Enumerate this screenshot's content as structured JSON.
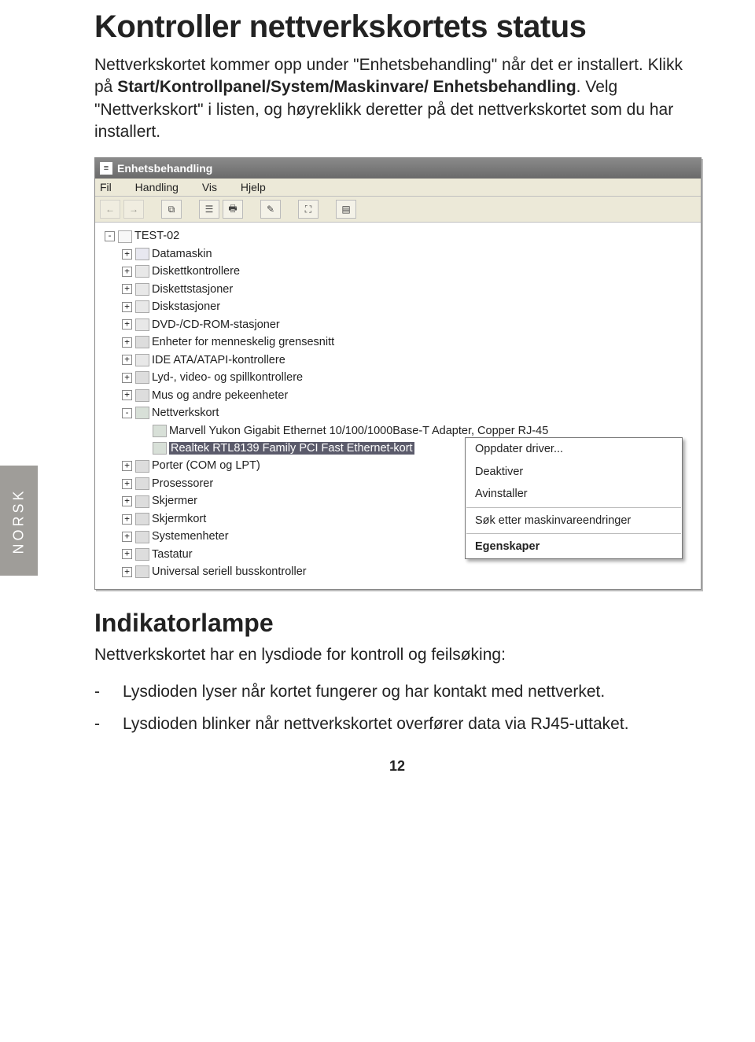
{
  "sidebar_tab": "NORSK",
  "title": "Kontroller nettverkskortets status",
  "intro_1": "Nettverkskortet kommer opp under \"Enhetsbehandling\" når det er installert. Klikk på ",
  "intro_bold": "Start/Kontrollpanel/System/Maskinvare/ Enhetsbehandling",
  "intro_2": ". Velg \"Nettverkskort\" i listen, og høyreklikk deretter på det nettverkskortet som du har installert.",
  "window": {
    "title": "Enhetsbehandling",
    "menu": [
      "Fil",
      "Handling",
      "Vis",
      "Hjelp"
    ],
    "root": "TEST-02",
    "nodes": [
      "Datamaskin",
      "Diskettkontrollere",
      "Diskettstasjoner",
      "Diskstasjoner",
      "DVD-/CD-ROM-stasjoner",
      "Enheter for menneskelig grensesnitt",
      "IDE ATA/ATAPI-kontrollere",
      "Lyd-, video- og spillkontrollere",
      "Mus og andre pekeenheter"
    ],
    "net_parent": "Nettverkskort",
    "net_children": [
      "Marvell Yukon Gigabit Ethernet 10/100/1000Base-T Adapter, Copper RJ-45",
      "Realtek RTL8139 Family PCI Fast Ethernet-kort"
    ],
    "nodes_after": [
      "Porter (COM og LPT)",
      "Prosessorer",
      "Skjermer",
      "Skjermkort",
      "Systemenheter",
      "Tastatur",
      "Universal seriell busskontroller"
    ],
    "context_menu": [
      "Oppdater driver...",
      "Deaktiver",
      "Avinstaller",
      "Søk etter maskinvareendringer",
      "Egenskaper"
    ]
  },
  "subhead": "Indikatorlampe",
  "sub_intro": "Nettverkskortet har en lysdiode for kontroll og feilsøking:",
  "bullets": [
    "Lysdioden lyser når kortet fungerer og har kontakt med nettverket.",
    "Lysdioden blinker når nettverkskortet overfører data via RJ45-uttaket."
  ],
  "page_number": "12"
}
